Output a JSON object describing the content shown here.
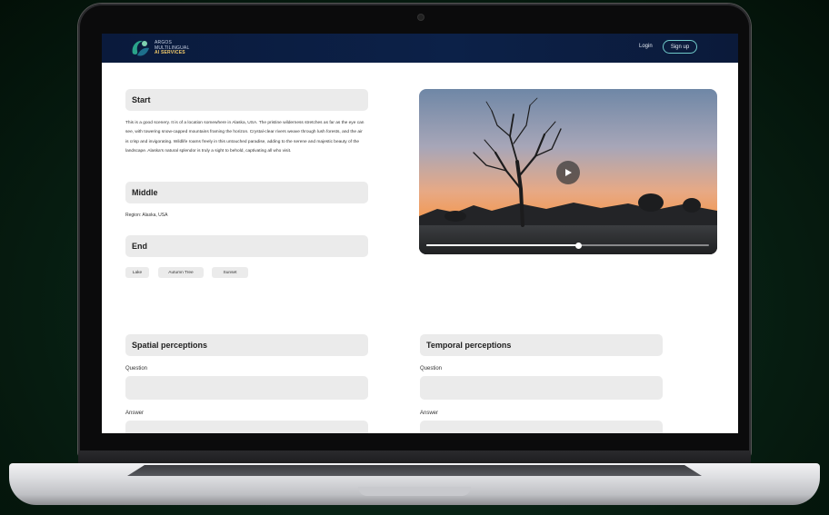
{
  "brand": {
    "line1": "ARGOS",
    "line2": "MULTILINGUAL",
    "line3": "AI SERVICES"
  },
  "nav": {
    "login": "Login",
    "signup": "Sign up"
  },
  "sections": {
    "start": {
      "title": "Start",
      "text": "This is a good scenery. It is of a location somewhere in Alaska, USA. The pristine wilderness stretches as far as the eye can see, with towering snow-capped mountains framing the horizon. Crystal-clear rivers weave through lush forests, and the air is crisp and invigorating. Wildlife roams freely in this untouched paradise, adding to the serene and majestic beauty of the landscape. Alaska's natural splendor is truly a sight to behold, captivating all who visit."
    },
    "middle": {
      "title": "Middle",
      "region": "Region: Alaska, USA"
    },
    "end": {
      "title": "End",
      "tags": [
        "Lake",
        "Autumn Tree",
        "Sunset"
      ]
    }
  },
  "video": {
    "progress": 0.54
  },
  "perceptions": {
    "spatial": {
      "title": "Spatial perceptions",
      "question_label": "Question",
      "answer_label": "Answer"
    },
    "temporal": {
      "title": "Temporal perceptions",
      "question_label": "Question",
      "answer_label": "Answer"
    }
  }
}
